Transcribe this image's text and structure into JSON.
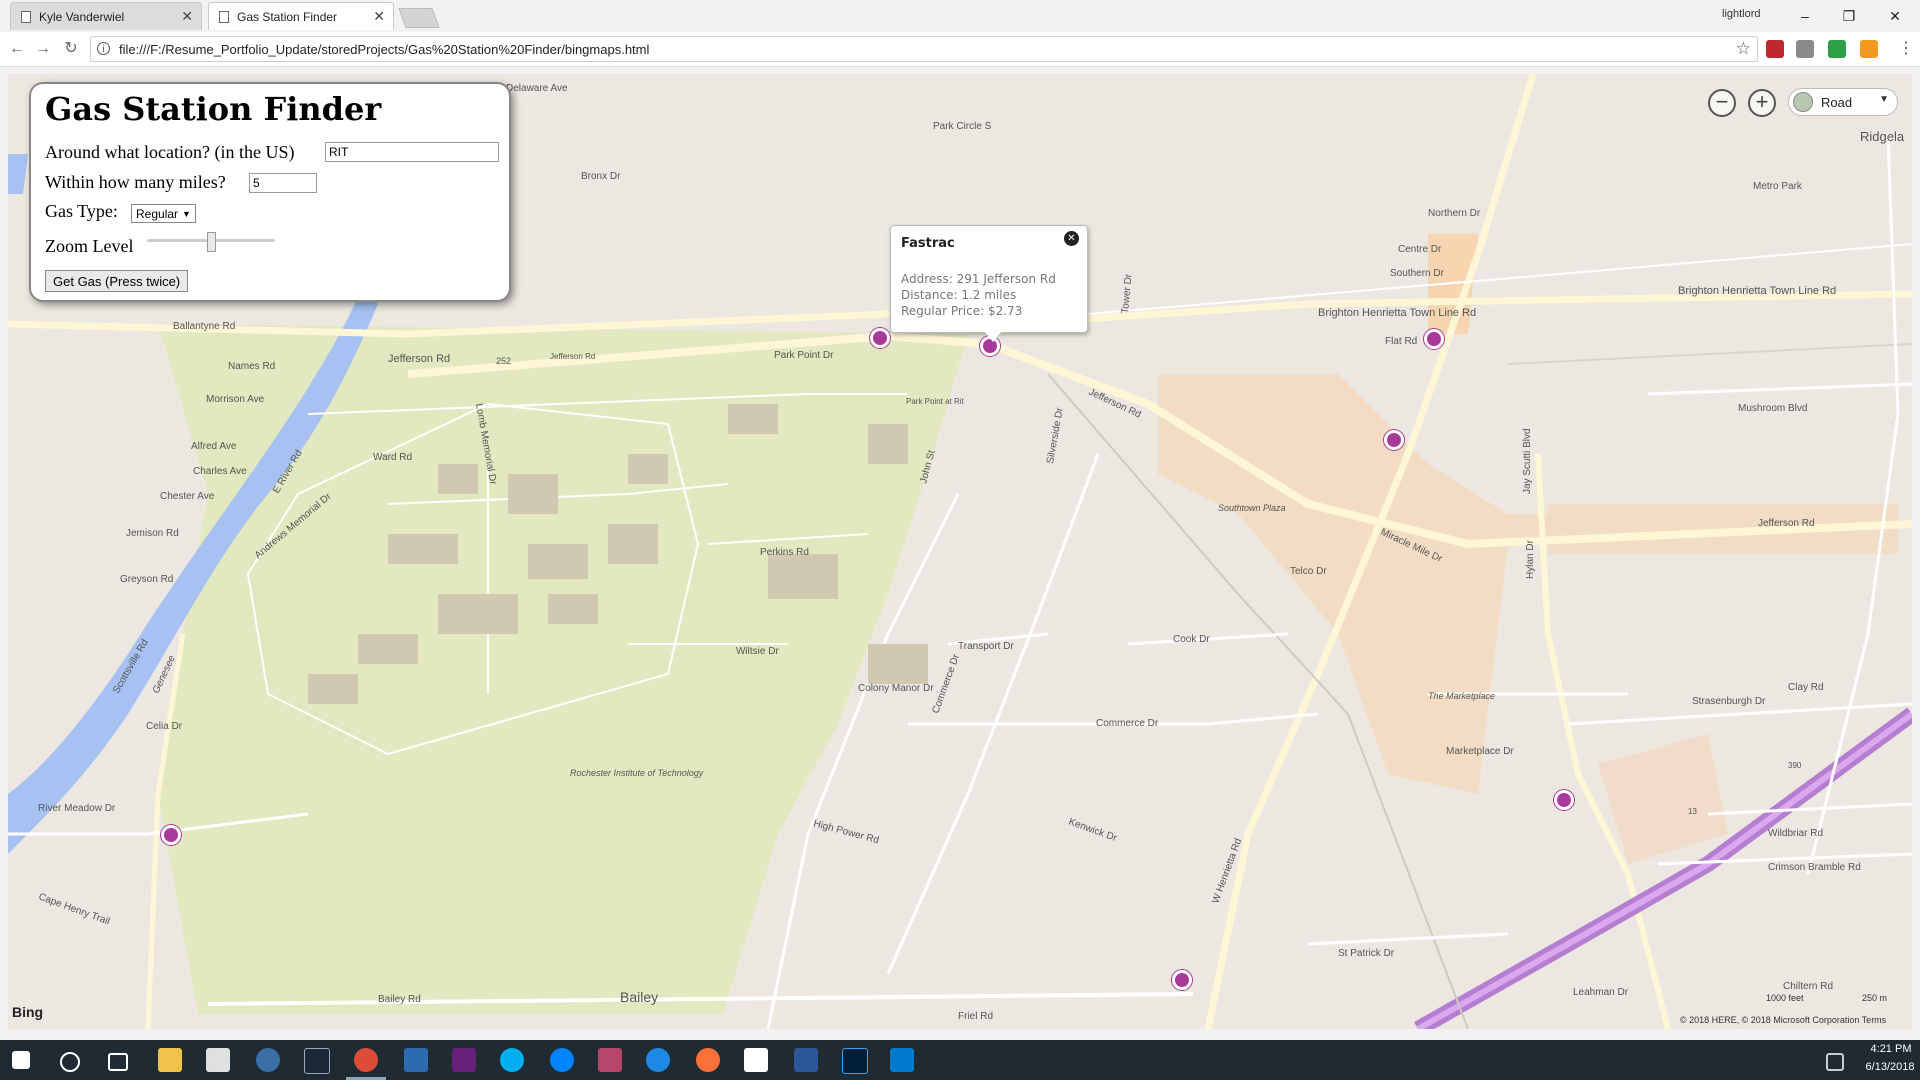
{
  "browser": {
    "tabs": [
      {
        "label": "Kyle Vanderwiel",
        "active": false
      },
      {
        "label": "Gas Station Finder",
        "active": true
      }
    ],
    "profile_name": "lightlord",
    "url": "file:///F:/Resume_Portfolio_Update/storedProjects/Gas%20Station%20Finder/bingmaps.html",
    "window_controls": {
      "minimize": "–",
      "restore": "❐",
      "close": "✕"
    }
  },
  "form": {
    "title": "Gas Station Finder",
    "location_label": "Around what location? (in the US)",
    "location_value": "RIT",
    "miles_label": "Within how many miles?",
    "miles_value": "5",
    "gas_type_label": "Gas Type:",
    "gas_type_selected": "Regular",
    "zoom_label": "Zoom Level",
    "submit_label": "Get Gas (Press twice)"
  },
  "map": {
    "type_selected": "Road",
    "zoom_in": "+",
    "zoom_out": "−",
    "labels": {
      "delaware": "Delaware Ave",
      "park_circle": "Park Circle S",
      "bronx": "Bronx Dr",
      "ballantyne": "Ballantyne Rd",
      "names": "Names Rd",
      "morrison": "Morrison Ave",
      "alfred": "Alfred Ave",
      "charles": "Charles Ave",
      "chester": "Chester Ave",
      "jemison": "Jemison Rd",
      "greyson": "Greyson Rd",
      "celia": "Celia Dr",
      "river_meadow": "River Meadow Dr",
      "cape_henry": "Cape Henry Trail",
      "bailey_rd": "Bailey Rd",
      "bailey": "Bailey",
      "jefferson_rd": "Jefferson Rd",
      "jefferson_rd2": "Jefferson Rd",
      "jefferson_rd3": "Jefferson Rd",
      "jefferson_rd4": "Jefferson Rd",
      "route_252": "252",
      "park_point": "Park Point Dr",
      "park_point_rit": "Park Point at Rit",
      "ward": "Ward Rd",
      "perkins": "Perkins Rd",
      "wiltsie": "Wiltsie Dr",
      "colony_manor": "Colony Manor Dr",
      "rit": "Rochester Institute of Technology",
      "high_power": "High Power Rd",
      "transport": "Transport Dr",
      "cook": "Cook Dr",
      "commerce": "Commerce Dr",
      "telco": "Telco Dr",
      "kenwick": "Kenwick Dr",
      "st_patrick": "St Patrick Dr",
      "w_henrietta": "W Henrietta Rd",
      "brighton": "Brighton Henrietta Town Line Rd",
      "brighton2": "Brighton Henrietta Town Line Rd",
      "flat": "Flat Rd",
      "northern": "Northern Dr",
      "centre": "Centre Dr",
      "southern": "Southern Dr",
      "metro_park": "Metro Park",
      "ridgeland": "Ridgela",
      "mushroom": "Mushroom Blvd",
      "southtown": "Southtown Plaza",
      "marketplace": "The Marketplace",
      "miracle_mile": "Miracle Mile Dr",
      "hylan": "Hylan Dr",
      "jay_scutti": "Jay Scutti Blvd",
      "strasenburgh": "Strasenburgh Dr",
      "clay": "Clay Rd",
      "wildbriar": "Wildbriar Rd",
      "crimson_bramble": "Crimson Bramble Rd",
      "chiltern": "Chiltern Rd",
      "leahman": "Leahman Dr",
      "route_390": "390",
      "route_13": "13",
      "scottsville": "Scottsville Rd",
      "e_river": "E River Rd",
      "genesee": "Genesee",
      "andrews": "Andrews Memorial Dr",
      "friel": "Friel Rd",
      "john_st": "John St",
      "silverside": "Silverside Dr",
      "tower": "Tower Dr",
      "lomb": "Lomb Memorial Dr",
      "commerce_dr2": "Commerce Dr",
      "marketplace_dr": "Marketplace Dr"
    },
    "infobox": {
      "name": "Fastrac",
      "address": "Address: 291 Jefferson Rd",
      "distance": "Distance: 1.2 miles",
      "price": "Regular Price: $2.73"
    },
    "footer": {
      "logo": "Bing",
      "scale_feet": "1000 feet",
      "scale_meters": "250 m",
      "copyright": "© 2018 HERE, © 2018 Microsoft Corporation  Terms"
    }
  },
  "taskbar": {
    "time": "4:21 PM",
    "date": "6/13/2018"
  }
}
